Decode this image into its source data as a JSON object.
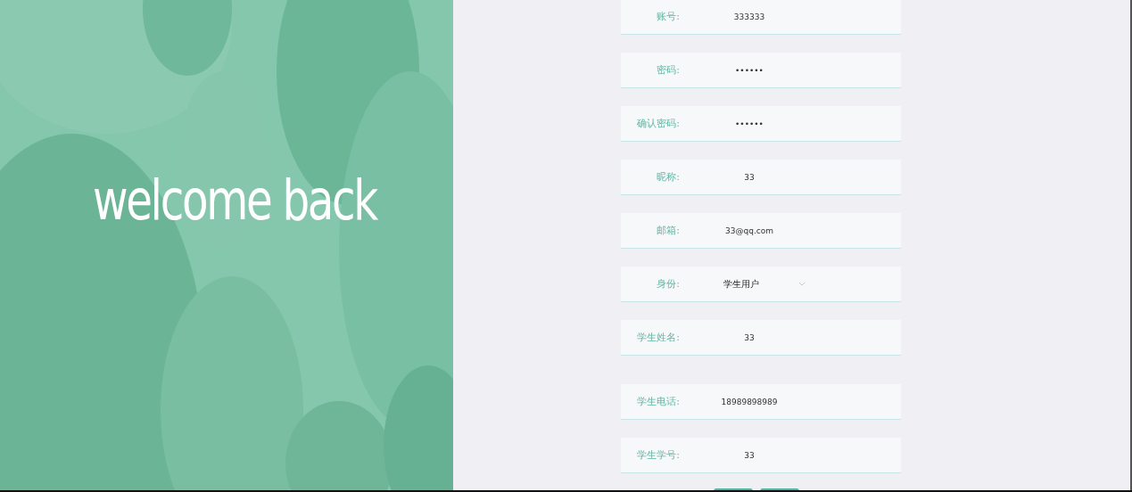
{
  "banner": {
    "kind": "picture",
    "heading": "welcome back"
  },
  "fields": [
    {
      "kind": "text",
      "label": "账号:",
      "value": "333333"
    },
    {
      "kind": "text",
      "label": "密码:",
      "value": "••••••"
    },
    {
      "kind": "text",
      "label": "确认密码:",
      "value": "••••••"
    },
    {
      "kind": "text",
      "label": "昵称:",
      "value": "33"
    },
    {
      "kind": "text",
      "label": "邮箱:",
      "value": "33@qq.com"
    },
    {
      "kind": "select",
      "label": "身份:",
      "value": "学生用户"
    },
    {
      "kind": "text",
      "label": "学生姓名:",
      "value": "33"
    },
    {
      "kind": "text",
      "label": "学生电话:",
      "value": "18989898989"
    },
    {
      "kind": "text",
      "label": "学生学号:",
      "value": "33"
    }
  ],
  "bottom_buttons": [
    {
      "kind": "primary"
    },
    {
      "kind": "primary"
    }
  ]
}
